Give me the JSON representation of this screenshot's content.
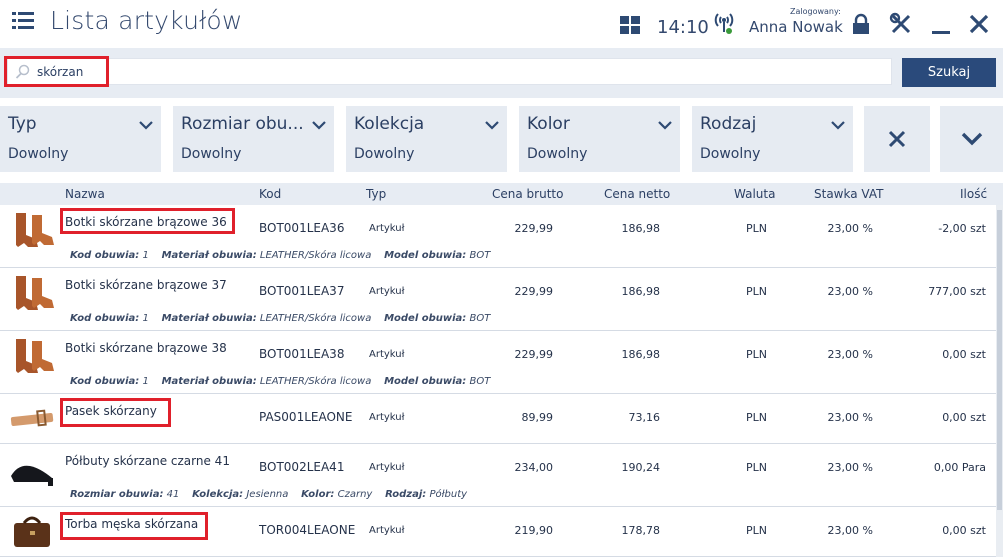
{
  "header": {
    "title": "Lista artykułów",
    "time": "14:10",
    "login_caption": "Zalogowany:",
    "user": "Anna Nowak"
  },
  "search": {
    "value": "skórzan",
    "button": "Szukaj"
  },
  "filters": [
    {
      "label": "Typ",
      "value": "Dowolny"
    },
    {
      "label": "Rozmiar obu...",
      "value": "Dowolny"
    },
    {
      "label": "Kolekcja",
      "value": "Dowolny"
    },
    {
      "label": "Kolor",
      "value": "Dowolny"
    },
    {
      "label": "Rodzaj",
      "value": "Dowolny"
    }
  ],
  "columns": {
    "name": "Nazwa",
    "code": "Kod",
    "type": "Typ",
    "gross": "Cena brutto",
    "net": "Cena netto",
    "currency": "Waluta",
    "vat": "Stawka VAT",
    "qty": "Ilość"
  },
  "rows": [
    {
      "name": "Botki skórzane brązowe 36",
      "code": "BOT001LEA36",
      "type": "Artykuł",
      "gross": "229,99",
      "net": "186,98",
      "currency": "PLN",
      "vat": "23,00 %",
      "qty": "-2,00 szt",
      "attrs": [
        {
          "k": "Kod obuwia:",
          "v": "1"
        },
        {
          "k": "Materiał obuwia:",
          "v": "LEATHER/Skóra licowa"
        },
        {
          "k": "Model obuwia:",
          "v": "BOT"
        }
      ]
    },
    {
      "name": "Botki skórzane brązowe 37",
      "code": "BOT001LEA37",
      "type": "Artykuł",
      "gross": "229,99",
      "net": "186,98",
      "currency": "PLN",
      "vat": "23,00 %",
      "qty": "777,00 szt",
      "attrs": [
        {
          "k": "Kod obuwia:",
          "v": "1"
        },
        {
          "k": "Materiał obuwia:",
          "v": "LEATHER/Skóra licowa"
        },
        {
          "k": "Model obuwia:",
          "v": "BOT"
        }
      ]
    },
    {
      "name": "Botki skórzane brązowe 38",
      "code": "BOT001LEA38",
      "type": "Artykuł",
      "gross": "229,99",
      "net": "186,98",
      "currency": "PLN",
      "vat": "23,00 %",
      "qty": "0,00 szt",
      "attrs": [
        {
          "k": "Kod obuwia:",
          "v": "1"
        },
        {
          "k": "Materiał obuwia:",
          "v": "LEATHER/Skóra licowa"
        },
        {
          "k": "Model obuwia:",
          "v": "BOT"
        }
      ]
    },
    {
      "name": "Pasek skórzany",
      "code": "PAS001LEAONE",
      "type": "Artykuł",
      "gross": "89,99",
      "net": "73,16",
      "currency": "PLN",
      "vat": "23,00 %",
      "qty": "0,00 szt",
      "attrs": []
    },
    {
      "name": "Półbuty skórzane czarne 41",
      "code": "BOT002LEA41",
      "type": "Artykuł",
      "gross": "234,00",
      "net": "190,24",
      "currency": "PLN",
      "vat": "23,00 %",
      "qty": "0,00 Para",
      "attrs": [
        {
          "k": "Rozmiar obuwia:",
          "v": "41"
        },
        {
          "k": "Kolekcja:",
          "v": "Jesienna"
        },
        {
          "k": "Kolor:",
          "v": "Czarny"
        },
        {
          "k": "Rodzaj:",
          "v": "Półbuty"
        }
      ]
    },
    {
      "name": "Torba męska skórzana",
      "code": "TOR004LEAONE",
      "type": "Artykuł",
      "gross": "219,90",
      "net": "178,78",
      "currency": "PLN",
      "vat": "23,00 %",
      "qty": "0,00 szt",
      "attrs": []
    }
  ]
}
